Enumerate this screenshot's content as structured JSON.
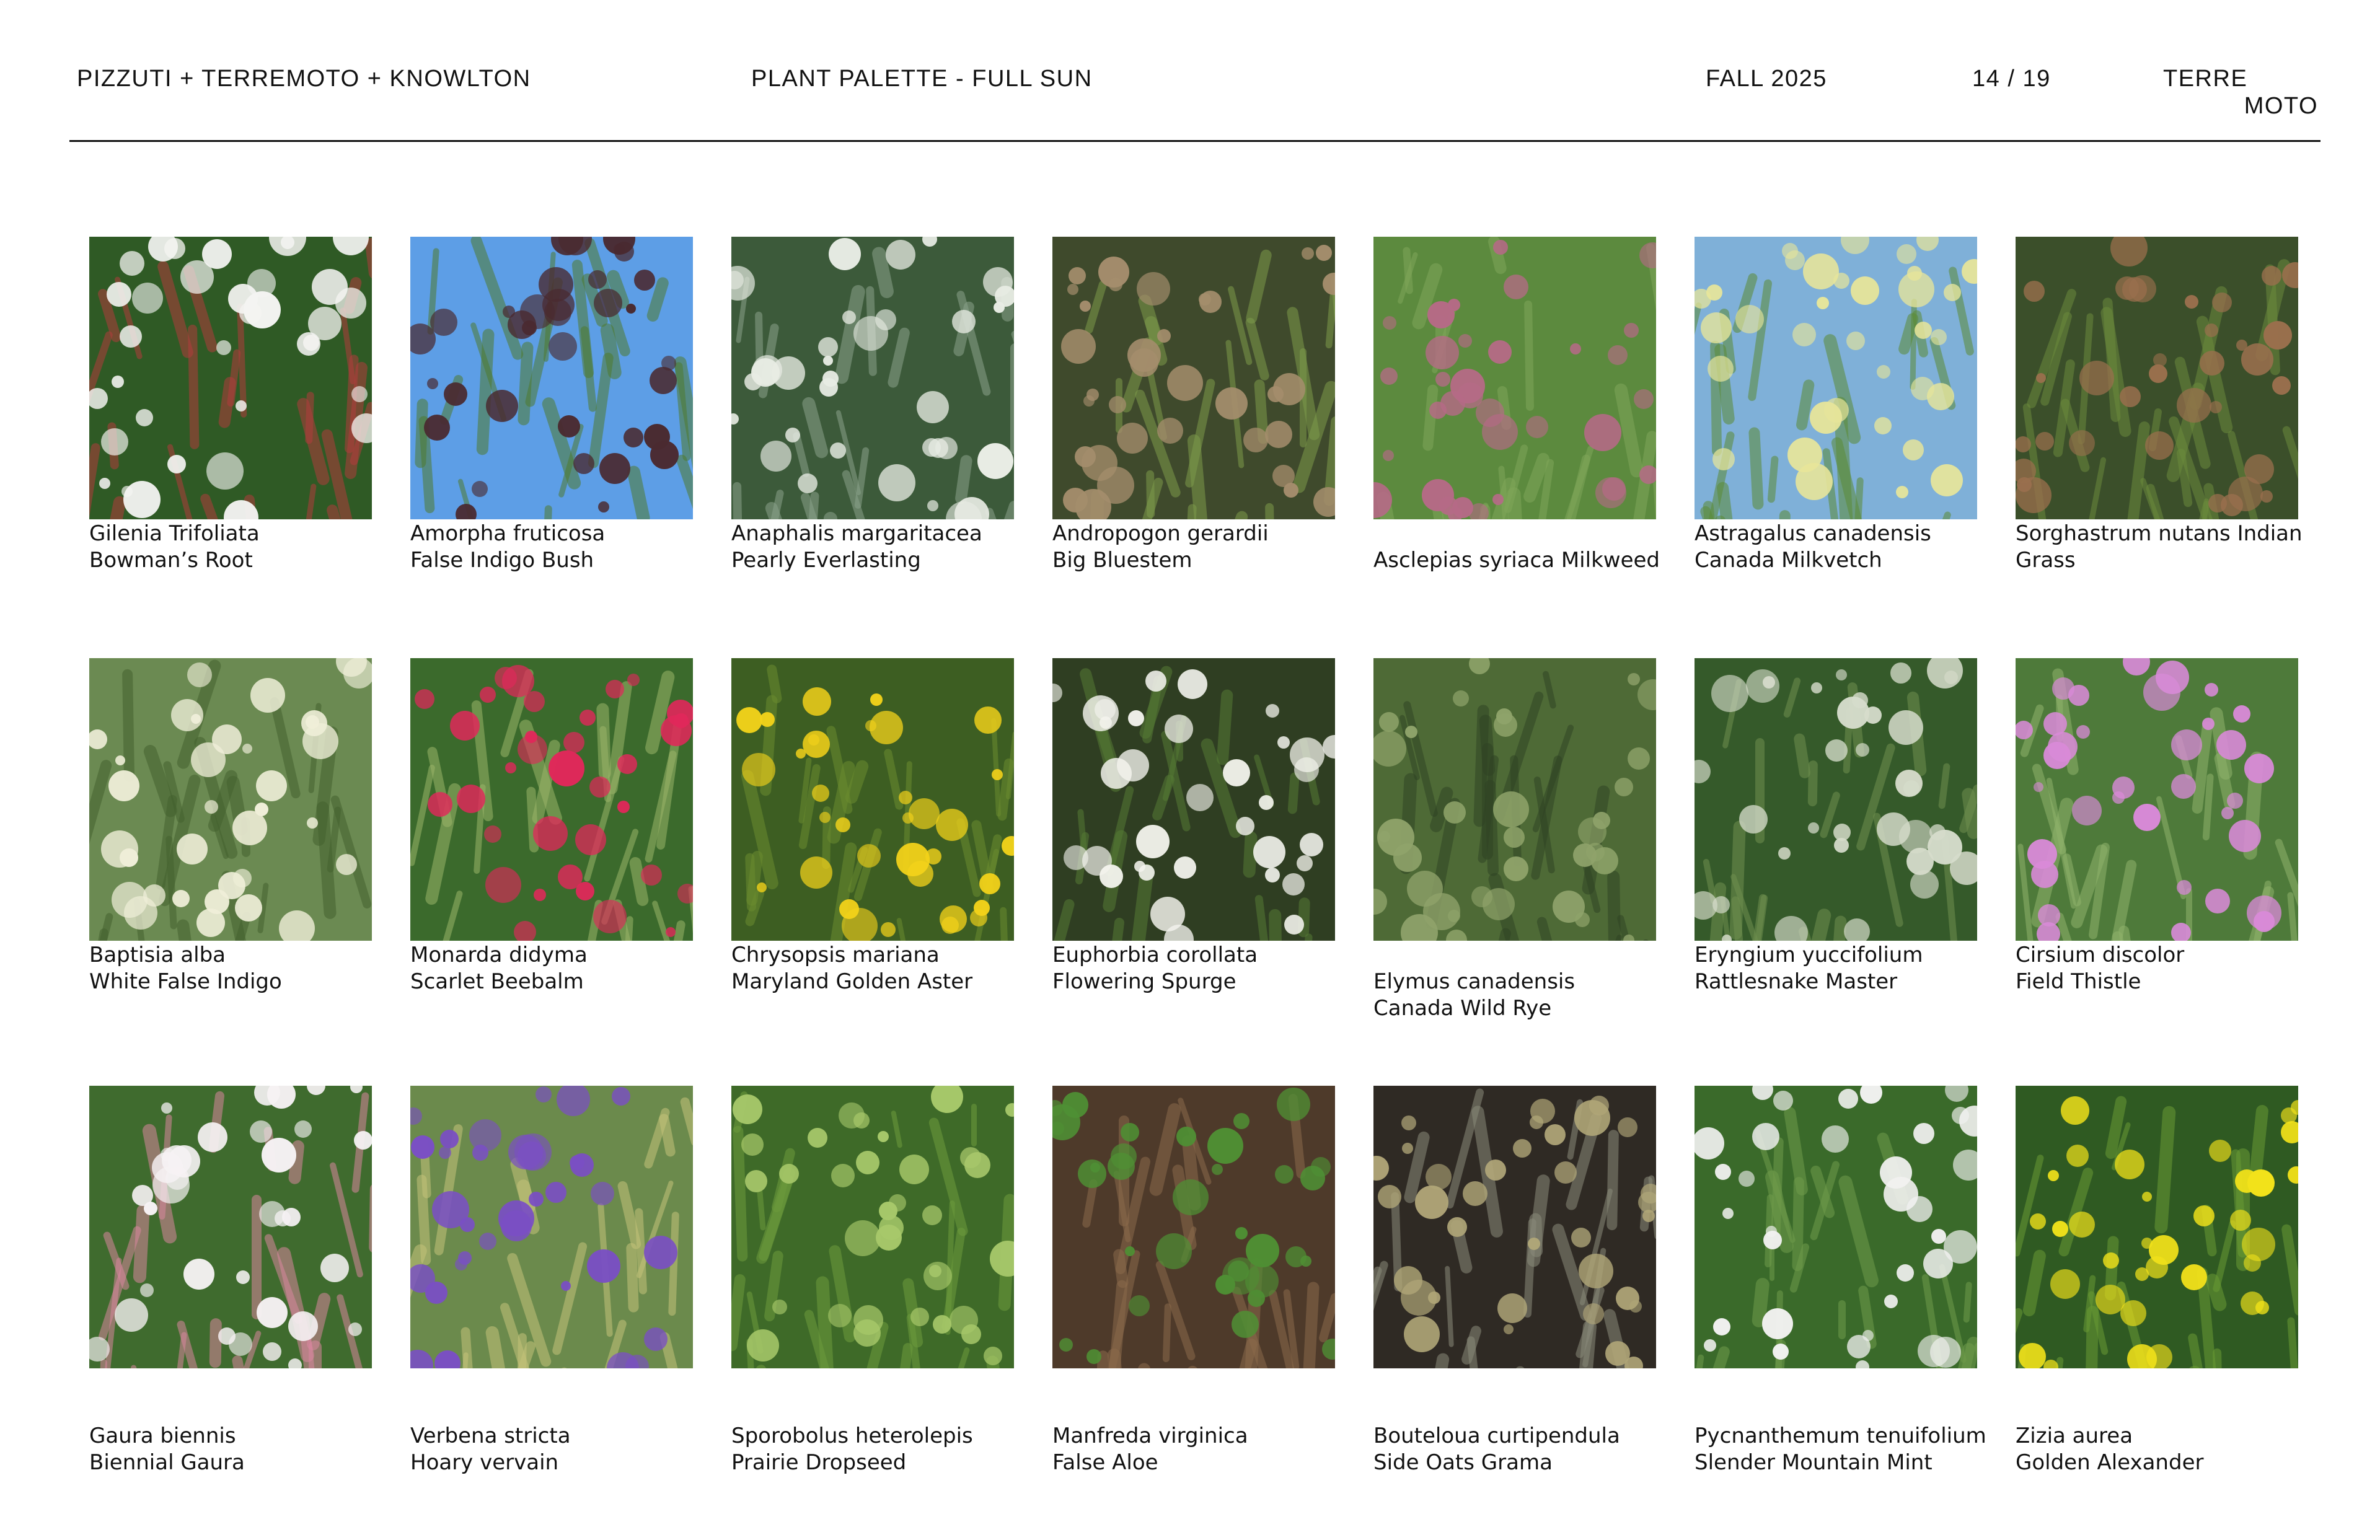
{
  "header": {
    "org": "PIZZUTI + TERREMOTO + KNOWLTON",
    "title": "PLANT PALETTE - FULL SUN",
    "season": "FALL 2025",
    "page": "14 / 19",
    "logo_line1": "TERRE",
    "logo_line2": "MOTO"
  },
  "plants": [
    {
      "line1": "Gilenia Trifoliata",
      "line2": "Bowman’s Root",
      "colors": [
        "#2f5a25",
        "#f4f4f2",
        "#b03c3c"
      ]
    },
    {
      "line1": "Amorpha fruticosa",
      "line2": "False Indigo Bush",
      "colors": [
        "#5d9ee6",
        "#4a2a30",
        "#4e7a2e"
      ]
    },
    {
      "line1": "Anaphalis margaritacea",
      "line2": "Pearly Everlasting",
      "colors": [
        "#3c5a3a",
        "#e8ece4",
        "#8aa38a"
      ]
    },
    {
      "line1": "Andropogon gerardii",
      "line2": "Big Bluestem",
      "colors": [
        "#3f4a2c",
        "#a48d6c",
        "#7d9a4a"
      ]
    },
    {
      "line1": "",
      "line2": "Asclepias syriaca Milkweed",
      "colors": [
        "#5c8a3e",
        "#b56a86",
        "#7fa65a"
      ]
    },
    {
      "line1": "Astragalus canadensis",
      "line2": "Canada Milkvetch",
      "colors": [
        "#7fb0d8",
        "#e7e59a",
        "#5b8a34"
      ]
    },
    {
      "line1": "Sorghastrum nutans Indian",
      "line2": "Grass",
      "colors": [
        "#3b4f2a",
        "#9a6f4d",
        "#6b8a3c"
      ]
    },
    {
      "line1": "Baptisia alba",
      "line2": "White False Indigo",
      "colors": [
        "#6b8a52",
        "#efeed8",
        "#44612e"
      ]
    },
    {
      "line1": "Monarda didyma",
      "line2": "Scarlet Beebalm",
      "colors": [
        "#3b6a2c",
        "#e0285a",
        "#9bb56a"
      ]
    },
    {
      "line1": "Chrysopsis mariana",
      "line2": "Maryland Golden Aster",
      "colors": [
        "#3d5e22",
        "#f3d21a",
        "#6c8c30"
      ]
    },
    {
      "line1": "Euphorbia corollata",
      "line2": "Flowering Spurge",
      "colors": [
        "#2f3e22",
        "#f4f4ee",
        "#567a34"
      ]
    },
    {
      "line1": "",
      "line2": "Elymus canadensis",
      "line3": "Canada Wild Rye",
      "colors": [
        "#4e6a36",
        "#8fa36a",
        "#2f4424"
      ]
    },
    {
      "line1": "Eryngium yuccifolium",
      "line2": "Rattlesnake Master",
      "colors": [
        "#355a2a",
        "#d6dccb",
        "#6f8f4f"
      ]
    },
    {
      "line1": "Cirsium discolor",
      "line2": "Field Thistle",
      "colors": [
        "#4e7a3a",
        "#d98ad8",
        "#8fb26c"
      ]
    },
    {
      "line1": "",
      "line2": "",
      "line3": "Gaura biennis",
      "line4": "Biennial Gaura",
      "colors": [
        "#3f6b2e",
        "#f6f2f4",
        "#d9869e"
      ]
    },
    {
      "line1": "",
      "line2": "",
      "line3": "Verbena stricta",
      "line4": "Hoary vervain",
      "colors": [
        "#6b8a4c",
        "#7a4fc4",
        "#c5c27a"
      ]
    },
    {
      "line1": "",
      "line2": "",
      "line3": "Sporobolus heterolepis",
      "line4": "Prairie Dropseed",
      "colors": [
        "#3e6a28",
        "#a7c86a",
        "#6e9a3c"
      ]
    },
    {
      "line1": "",
      "line2": "",
      "line3": "Manfreda virginica",
      "line4": "False Aloe",
      "colors": [
        "#4e3a2a",
        "#4f8f34",
        "#8a6a4a"
      ]
    },
    {
      "line1": "",
      "line2": "",
      "line3": "Bouteloua curtipendula",
      "line4": "Side Oats Grama",
      "colors": [
        "#2f2a24",
        "#b0a678",
        "#8a8a7a"
      ]
    },
    {
      "line1": "",
      "line2": "",
      "line3": "Pycnanthemum tenuifolium",
      "line4": "Slender Mountain Mint",
      "colors": [
        "#3a6a2a",
        "#f1f1f0",
        "#6f9a4a"
      ]
    },
    {
      "line1": "",
      "line2": "",
      "line3": "Zizia aurea",
      "line4": "Golden Alexander",
      "colors": [
        "#2f5a22",
        "#f2e21a",
        "#6a9a34"
      ]
    }
  ]
}
